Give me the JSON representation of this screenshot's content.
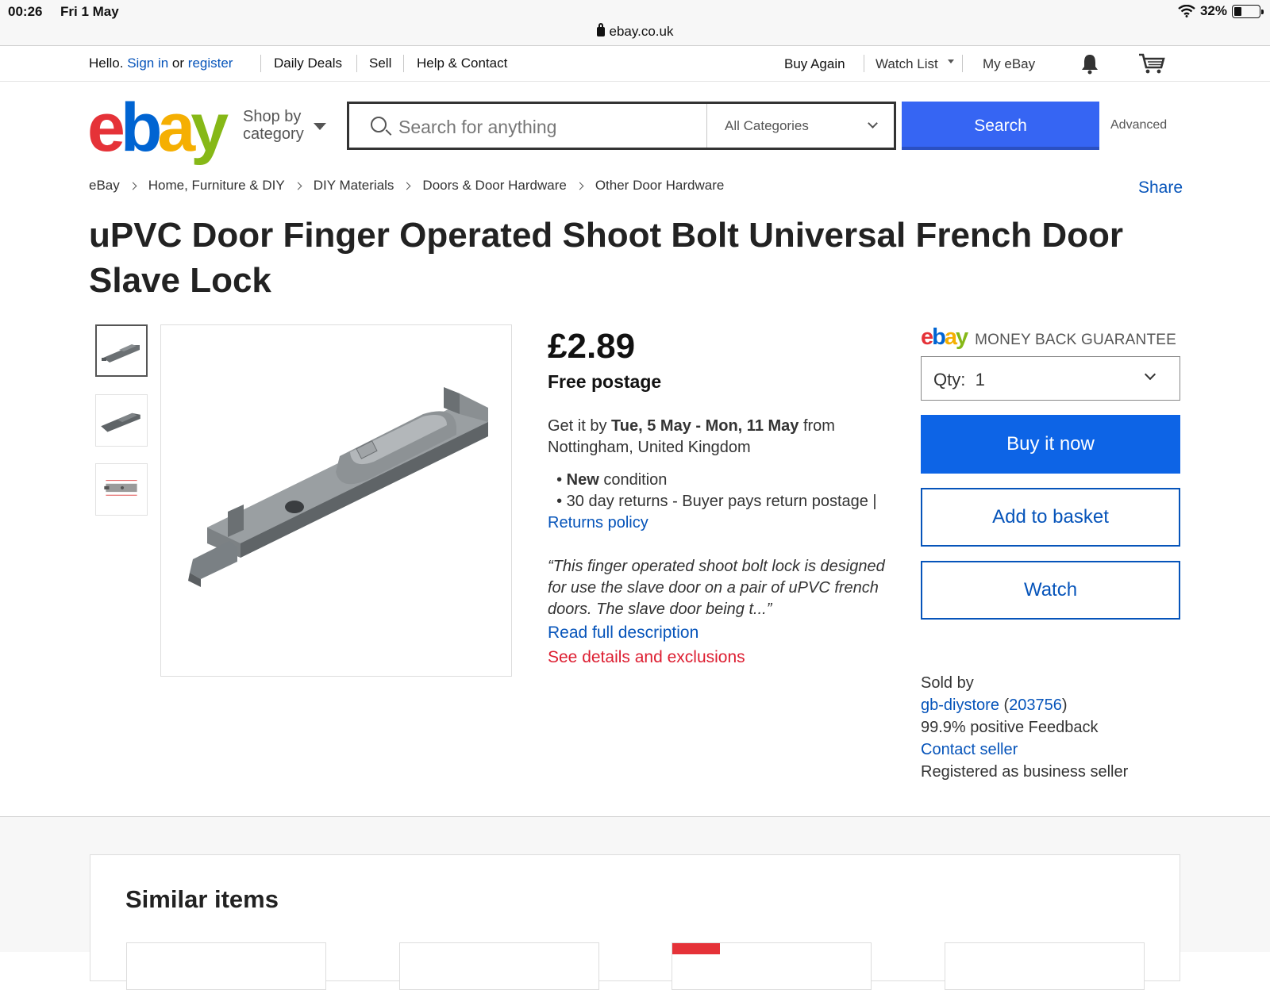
{
  "status": {
    "time": "00:26",
    "date": "Fri 1 May",
    "url": "ebay.co.uk",
    "battery": "32%"
  },
  "topnav": {
    "hello": "Hello.",
    "sign_in": "Sign in",
    "or": "or",
    "register": "register",
    "daily_deals": "Daily Deals",
    "sell": "Sell",
    "help": "Help & Contact",
    "buy_again": "Buy Again",
    "watch_list": "Watch List",
    "my_ebay": "My eBay"
  },
  "header": {
    "logo": {
      "e": "e",
      "b": "b",
      "a": "a",
      "y": "y"
    },
    "shop_by_1": "Shop by",
    "shop_by_2": "category",
    "search_placeholder": "Search for anything",
    "category": "All Categories",
    "search_button": "Search",
    "advanced": "Advanced"
  },
  "breadcrumbs": [
    "eBay",
    "Home, Furniture & DIY",
    "DIY Materials",
    "Doors & Door Hardware",
    "Other Door Hardware"
  ],
  "share": "Share",
  "title": "uPVC Door Finger Operated Shoot Bolt Universal French Door Slave Lock",
  "listing": {
    "price": "£2.89",
    "postage": "Free postage",
    "delivery_prefix": "Get it by",
    "delivery_dates": "Tue, 5 May - Mon, 11 May",
    "delivery_from": "from",
    "delivery_location": "Nottingham, United Kingdom",
    "condition_bold": "New",
    "condition_rest": "condition",
    "returns_text": "30 day returns - Buyer pays return postage |",
    "returns_policy": "Returns policy",
    "quote": "“This finger operated shoot bolt lock is designed for use the slave door on a pair of uPVC french doors. The slave door being t...”",
    "read_full": "Read full description",
    "see_details": "See details and exclusions"
  },
  "buybox": {
    "mbg_logo": "ebay",
    "mbg_text": "MONEY BACK GUARANTEE",
    "qty_label": "Qty:",
    "qty_value": "1",
    "buy_now": "Buy it now",
    "add_basket": "Add to basket",
    "watch": "Watch"
  },
  "seller": {
    "sold_by": "Sold by",
    "name": "gb-diystore",
    "score": "203756",
    "feedback": "99.9% positive Feedback",
    "contact": "Contact seller",
    "registered": "Registered as business seller"
  },
  "similar": {
    "heading": "Similar items"
  },
  "colors": {
    "ebay_red": "#e53238",
    "ebay_blue": "#0064d2",
    "ebay_yellow": "#f5af02",
    "ebay_green": "#86b817",
    "search_blue": "#3665f3",
    "link_blue": "#0654ba",
    "alert_red": "#dd1e31"
  }
}
